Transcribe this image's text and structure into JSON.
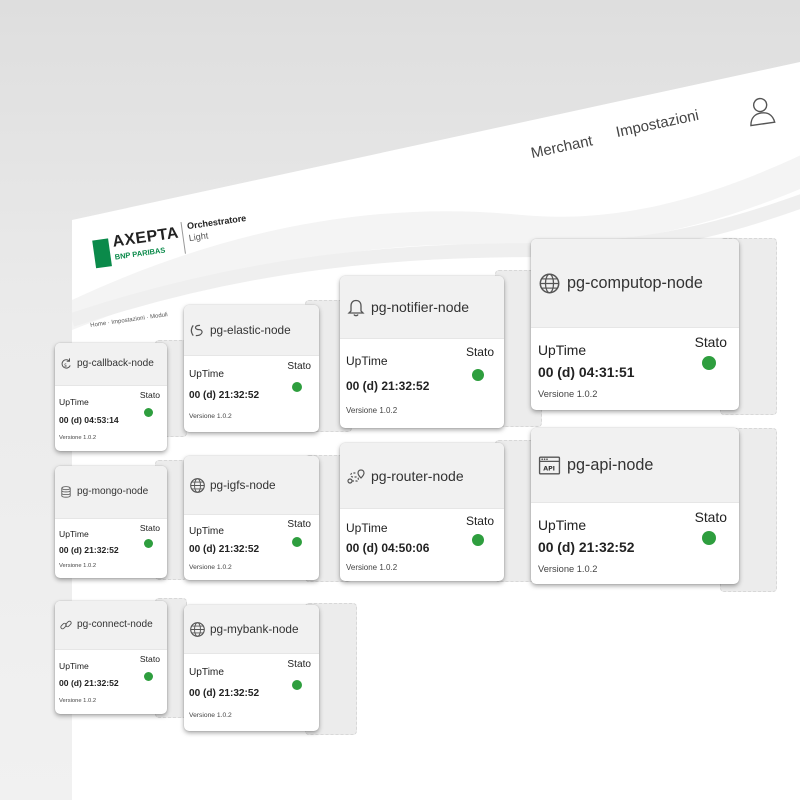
{
  "header": {
    "nav": [
      "Merchant",
      "Impostazioni"
    ],
    "user_icon": "user-icon"
  },
  "logo": {
    "brand": "AXEPTA",
    "sub": "BNP PARIBAS",
    "product": "Orchestratore",
    "product_sub": "Light"
  },
  "breadcrumb": "Home · Impostazioni · Moduli",
  "labels": {
    "uptime": "UpTime",
    "stato": "Stato"
  },
  "colors": {
    "status_ok": "#2e9e3e",
    "brand_green": "#0a8a4a"
  },
  "cards": [
    {
      "title": "pg-callback-node",
      "icon": "refresh-icon",
      "uptime": "00 (d) 04:53:14",
      "versione": "Versione 1.0.2",
      "status": "ok"
    },
    {
      "title": "pg-elastic-node",
      "icon": "elastic-icon",
      "uptime": "00 (d) 21:32:52",
      "versione": "Versione 1.0.2",
      "status": "ok"
    },
    {
      "title": "pg-notifier-node",
      "icon": "bell-icon",
      "uptime": "00 (d) 21:32:52",
      "versione": "Versione 1.0.2",
      "status": "ok"
    },
    {
      "title": "pg-computop-node",
      "icon": "globe-icon",
      "uptime": "00 (d) 04:31:51",
      "versione": "Versione 1.0.2",
      "status": "ok"
    },
    {
      "title": "pg-mongo-node",
      "icon": "database-icon",
      "uptime": "00 (d) 21:32:52",
      "versione": "Versione 1.0.2",
      "status": "ok"
    },
    {
      "title": "pg-igfs-node",
      "icon": "globe-icon",
      "uptime": "00 (d) 21:32:52",
      "versione": "Versione 1.0.2",
      "status": "ok"
    },
    {
      "title": "pg-router-node",
      "icon": "route-icon",
      "uptime": "00 (d) 04:50:06",
      "versione": "Versione 1.0.2",
      "status": "ok"
    },
    {
      "title": "pg-api-node",
      "icon": "api-icon",
      "api_text": "API",
      "uptime": "00 (d) 21:32:52",
      "versione": "Versione 1.0.2",
      "status": "ok"
    },
    {
      "title": "pg-connect-node",
      "icon": "link-icon",
      "uptime": "00 (d) 21:32:52",
      "versione": "Versione 1.0.2",
      "status": "ok"
    },
    {
      "title": "pg-mybank-node",
      "icon": "globe-icon",
      "uptime": "00 (d) 21:32:52",
      "versione": "Versione 1.0.2",
      "status": "ok"
    }
  ]
}
